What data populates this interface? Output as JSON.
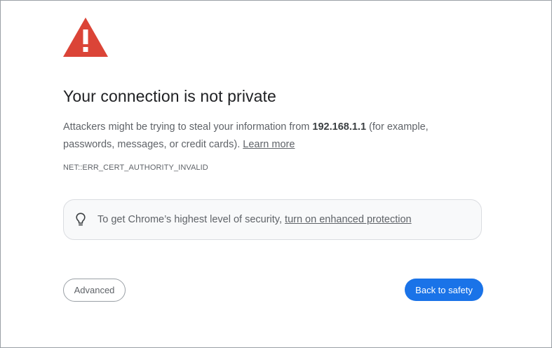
{
  "page": {
    "title": "Your connection is not private",
    "message_prefix": "Attackers might be trying to steal your information from ",
    "host": "192.168.1.1",
    "message_suffix": " (for example, passwords, messages, or credit cards). ",
    "learn_more_label": "Learn more",
    "error_code": "NET::ERR_CERT_AUTHORITY_INVALID"
  },
  "tip": {
    "icon": "lightbulb-icon",
    "prefix": "To get Chrome’s highest level of security, ",
    "link_label": "turn on enhanced protection"
  },
  "buttons": {
    "advanced_label": "Advanced",
    "back_label": "Back to safety"
  },
  "colors": {
    "warning_red": "#db4437",
    "primary_blue": "#1a73e8",
    "text_gray": "#5f6368"
  }
}
